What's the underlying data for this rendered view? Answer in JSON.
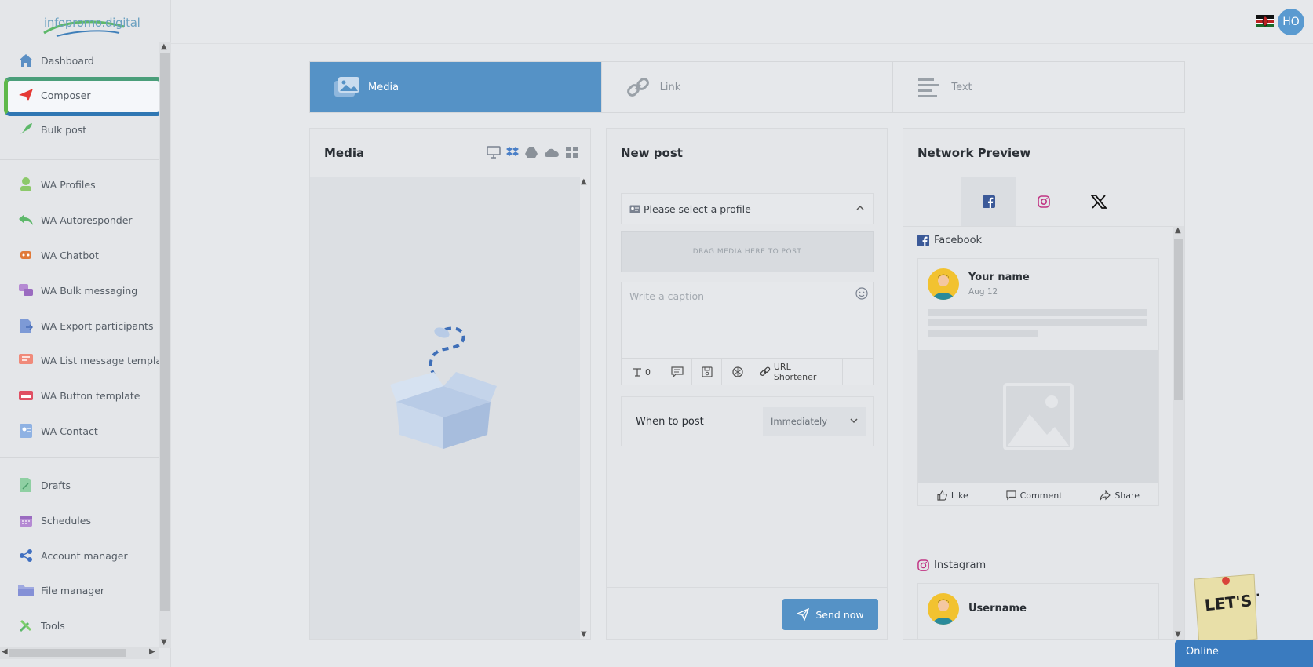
{
  "logo": {
    "text": "infopromo.digital"
  },
  "topbar": {
    "avatar_initials": "HO"
  },
  "sidebar": {
    "items": [
      {
        "label": "Dashboard",
        "icon": "home-icon"
      },
      {
        "label": "Composer",
        "icon": "paper-plane-icon"
      },
      {
        "label": "Bulk post",
        "icon": "rocket-icon"
      },
      {
        "label": "WA Profiles",
        "icon": "user-icon"
      },
      {
        "label": "WA Autoresponder",
        "icon": "reply-icon"
      },
      {
        "label": "WA Chatbot",
        "icon": "robot-icon"
      },
      {
        "label": "WA Bulk messaging",
        "icon": "chat-bubbles-icon"
      },
      {
        "label": "WA Export participants",
        "icon": "file-export-icon"
      },
      {
        "label": "WA List message template",
        "icon": "list-message-icon"
      },
      {
        "label": "WA Button template",
        "icon": "button-template-icon"
      },
      {
        "label": "WA Contact",
        "icon": "contact-card-icon"
      },
      {
        "label": "Drafts",
        "icon": "pencil-file-icon"
      },
      {
        "label": "Schedules",
        "icon": "calendar-icon"
      },
      {
        "label": "Account manager",
        "icon": "share-nodes-icon"
      },
      {
        "label": "File manager",
        "icon": "folder-icon"
      },
      {
        "label": "Tools",
        "icon": "tools-icon"
      }
    ]
  },
  "tabs": [
    {
      "label": "Media",
      "icon": "images-icon",
      "active": true
    },
    {
      "label": "Link",
      "icon": "link-icon",
      "active": false
    },
    {
      "label": "Text",
      "icon": "text-align-icon",
      "active": false
    }
  ],
  "media_panel": {
    "title": "Media"
  },
  "post_panel": {
    "title": "New post",
    "profile_select": "Please select a profile",
    "dropzone": "DRAG MEDIA HERE TO POST",
    "caption_placeholder": "Write a caption",
    "counter": "0",
    "url_shortener": "URL Shortener",
    "when_label": "When to post",
    "when_value": "Immediately",
    "send_label": "Send now"
  },
  "preview_panel": {
    "title": "Network Preview",
    "facebook_label": "Facebook",
    "fb_name": "Your name",
    "fb_date": "Aug 12",
    "like": "Like",
    "comment": "Comment",
    "share": "Share",
    "instagram_label": "Instagram",
    "ig_name": "Username"
  },
  "widgets": {
    "online": "Online",
    "lets_talk": "LET'S TALK!"
  },
  "colors": {
    "accent": "#5592c6",
    "composer_icon": "#e53935",
    "facebook": "#3b5998",
    "instagram": "#c13584"
  }
}
